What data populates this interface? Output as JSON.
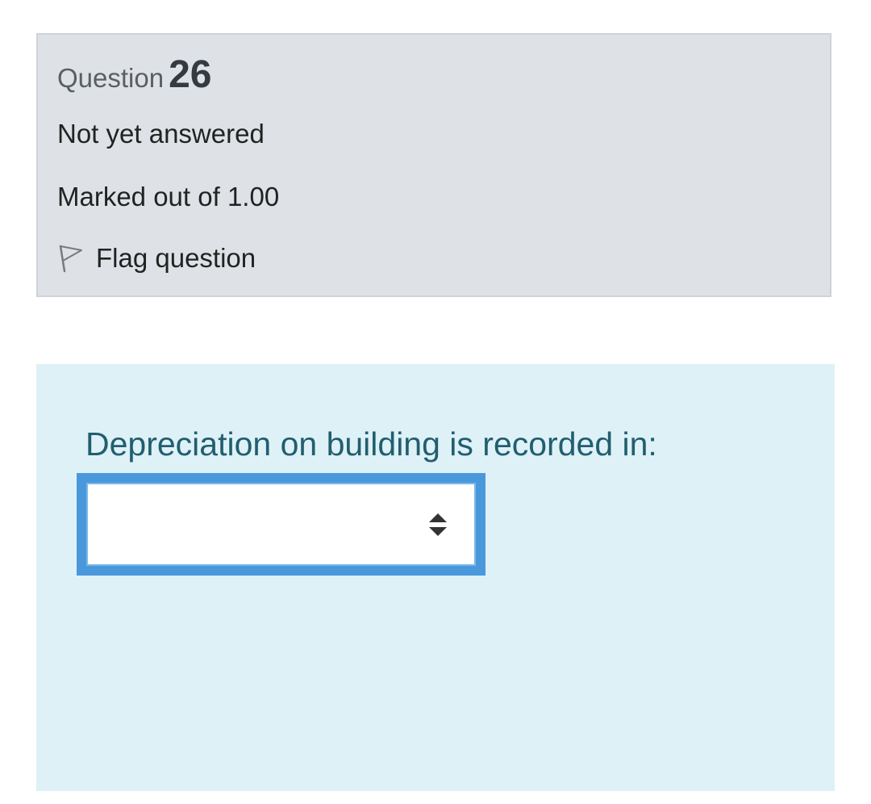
{
  "question": {
    "label": "Question",
    "number": "26",
    "status": "Not yet answered",
    "marks": "Marked out of 1.00",
    "flag_label": "Flag question"
  },
  "formulation": {
    "text": "Depreciation on building is recorded in:",
    "select_value": ""
  },
  "colors": {
    "info_background": "#dee2e6",
    "formulation_background": "#def1f7",
    "question_text": "#215e6f",
    "select_focus_border": "#4a98dc"
  },
  "icons": [
    "flag-icon",
    "select-sort-icon"
  ]
}
